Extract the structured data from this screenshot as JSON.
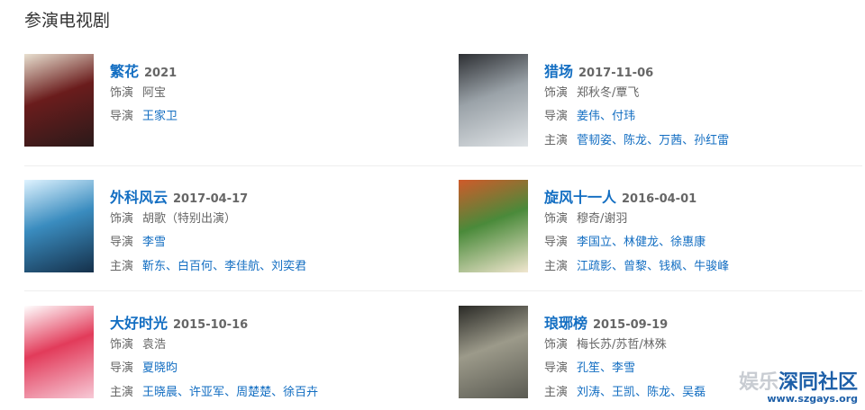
{
  "section_title": "参演电视剧",
  "labels": {
    "role": "饰演",
    "director": "导演",
    "cast": "主演"
  },
  "cards": [
    {
      "title": "繁花",
      "date": "2021",
      "poster_colors": [
        "#2a1a1a",
        "#6a1c1c",
        "#e8e0d0"
      ],
      "role": "阿宝",
      "directors": [
        "王家卫"
      ],
      "cast": []
    },
    {
      "title": "猎场",
      "date": "2017-11-06",
      "poster_colors": [
        "#dfe3e6",
        "#9aa2a8",
        "#2d2f33"
      ],
      "role": "郑秋冬/覃飞",
      "directors": [
        "姜伟",
        "付玮"
      ],
      "cast": [
        "菅韧姿",
        "陈龙",
        "万茜",
        "孙红雷"
      ]
    },
    {
      "title": "外科风云",
      "date": "2017-04-17",
      "poster_colors": [
        "#15304a",
        "#3a8cbf",
        "#dff3ff"
      ],
      "role": "胡歌（特别出演）",
      "directors": [
        "李雪"
      ],
      "cast": [
        "靳东",
        "白百何",
        "李佳航",
        "刘奕君"
      ]
    },
    {
      "title": "旋风十一人",
      "date": "2016-04-01",
      "poster_colors": [
        "#f1e6cf",
        "#4a8a3a",
        "#d05a2a"
      ],
      "role": "穆奇/谢羽",
      "directors": [
        "李国立",
        "林健龙",
        "徐惠康"
      ],
      "cast": [
        "江疏影",
        "曾黎",
        "钱枫",
        "牛骏峰"
      ]
    },
    {
      "title": "大好时光",
      "date": "2015-10-16",
      "poster_colors": [
        "#f7c9d6",
        "#e23b5a",
        "#ffffff"
      ],
      "role": "袁浩",
      "directors": [
        "夏晓昀"
      ],
      "cast": [
        "王晓晨",
        "许亚军",
        "周楚楚",
        "徐百卉"
      ]
    },
    {
      "title": "琅琊榜",
      "date": "2015-09-19",
      "poster_colors": [
        "#5a5a52",
        "#9c9a8a",
        "#2a2a26"
      ],
      "role": "梅长苏/苏哲/林殊",
      "directors": [
        "孔笙",
        "李雪"
      ],
      "cast": [
        "刘涛",
        "王凯",
        "陈龙",
        "吴磊"
      ]
    }
  ],
  "watermark": {
    "text_part1": "娱乐",
    "text_part2": "深同社区",
    "url": "www.szgays.org",
    "color1": "#c8ccd2",
    "color2": "#1d5fa8"
  }
}
